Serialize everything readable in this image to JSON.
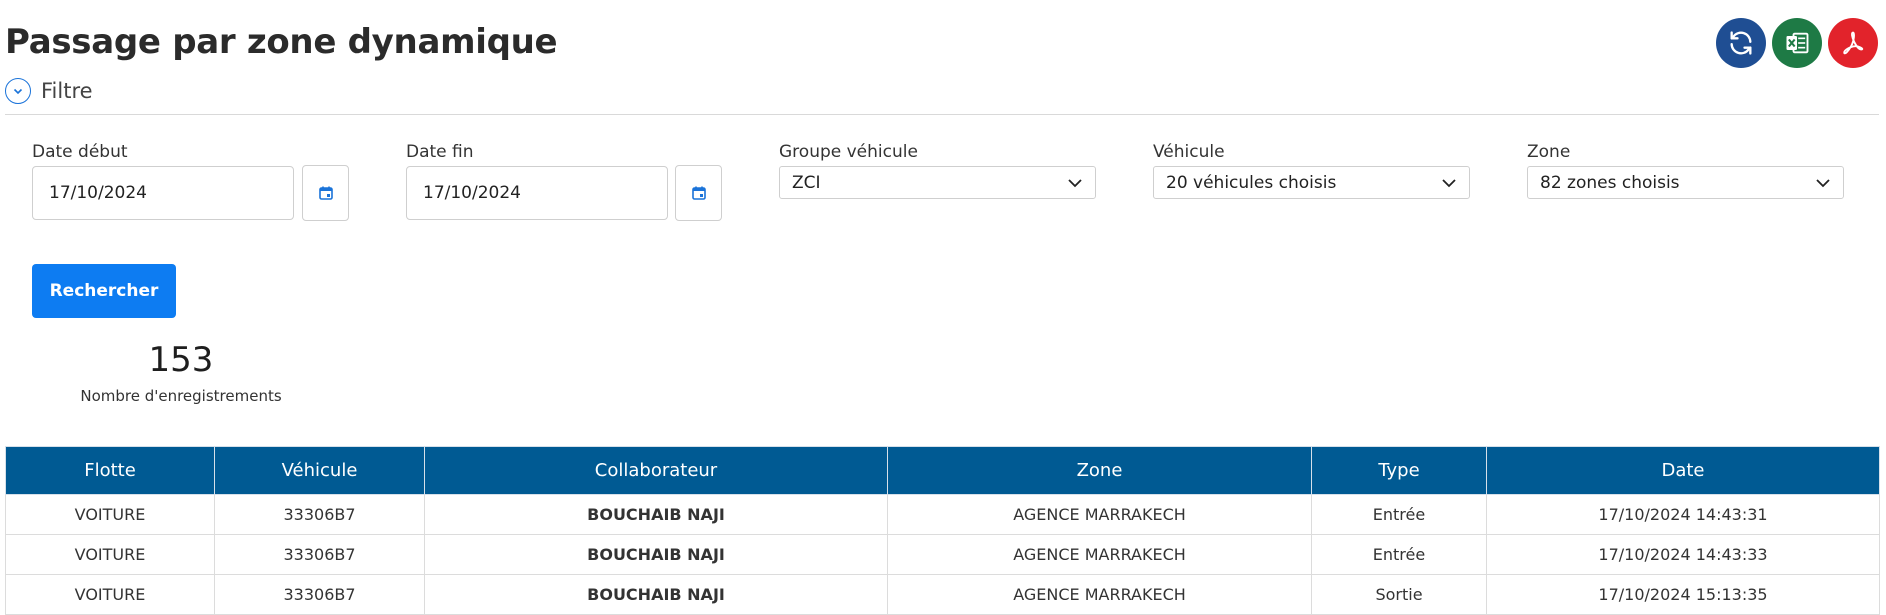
{
  "page": {
    "title": "Passage par zone dynamique"
  },
  "header_actions": [
    {
      "name": "refresh-button",
      "icon": "refresh-icon",
      "color": "#1f4e93"
    },
    {
      "name": "excel-export-button",
      "icon": "excel-icon",
      "color": "#1e7a45"
    },
    {
      "name": "pdf-export-button",
      "icon": "pdf-icon",
      "color": "#e2232b"
    }
  ],
  "filter": {
    "toggle_label": "Filtre",
    "date_start": {
      "label": "Date début",
      "value": "17/10/2024"
    },
    "date_end": {
      "label": "Date fin",
      "value": "17/10/2024"
    },
    "vehicle_group": {
      "label": "Groupe véhicule",
      "value": "ZCI"
    },
    "vehicle": {
      "label": "Véhicule",
      "value": "20 véhicules choisis"
    },
    "zone": {
      "label": "Zone",
      "value": "82 zones choisis"
    },
    "search_label": "Rechercher"
  },
  "summary": {
    "count": "153",
    "count_label": "Nombre d'enregistrements"
  },
  "table": {
    "columns": [
      "Flotte",
      "Véhicule",
      "Collaborateur",
      "Zone",
      "Type",
      "Date"
    ],
    "rows": [
      [
        "VOITURE",
        "33306B7",
        "BOUCHAIB NAJI",
        "AGENCE MARRAKECH",
        "Entrée",
        "17/10/2024 14:43:31"
      ],
      [
        "VOITURE",
        "33306B7",
        "BOUCHAIB NAJI",
        "AGENCE MARRAKECH",
        "Entrée",
        "17/10/2024 14:43:33"
      ],
      [
        "VOITURE",
        "33306B7",
        "BOUCHAIB NAJI",
        "AGENCE MARRAKECH",
        "Sortie",
        "17/10/2024 15:13:35"
      ]
    ]
  },
  "colors": {
    "accent": "#0d7cf2",
    "table_header": "#005a93",
    "link": "#1a73d9",
    "collaborator": "#27a822"
  }
}
